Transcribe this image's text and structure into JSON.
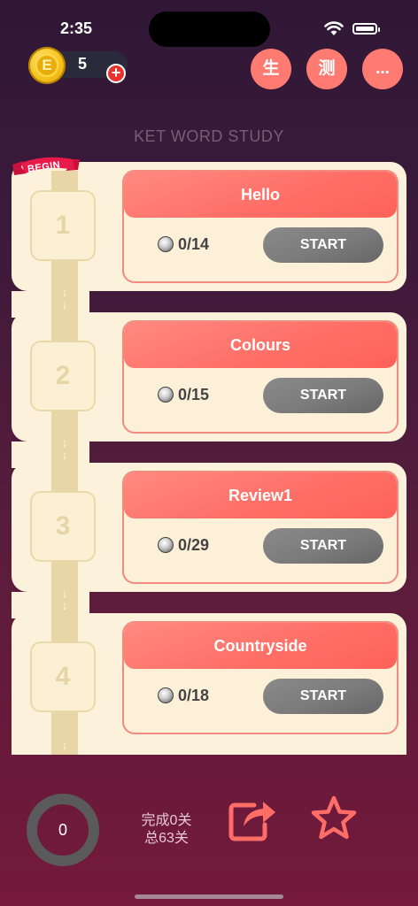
{
  "status": {
    "time": "2:35"
  },
  "coins": {
    "symbol": "E",
    "count": "5",
    "add": "+"
  },
  "header": {
    "buttons": [
      {
        "label": "生"
      },
      {
        "label": "测"
      },
      {
        "label": "..."
      }
    ],
    "title": "KET WORD STUDY"
  },
  "track": {
    "begin_label": "BEGIN"
  },
  "levels": [
    {
      "number": "1",
      "title": "Hello",
      "progress": "0/14",
      "button": "START"
    },
    {
      "number": "2",
      "title": "Colours",
      "progress": "0/15",
      "button": "START"
    },
    {
      "number": "3",
      "title": "Review1",
      "progress": "0/29",
      "button": "START"
    },
    {
      "number": "4",
      "title": "Countryside",
      "progress": "0/18",
      "button": "START"
    }
  ],
  "footer": {
    "completed_count": "0",
    "completed_text": "完成0关",
    "total_text": "总63关"
  },
  "colors": {
    "accent": "#ff6e66",
    "start_button": "#7b7b7b",
    "card": "#fcf2db"
  }
}
